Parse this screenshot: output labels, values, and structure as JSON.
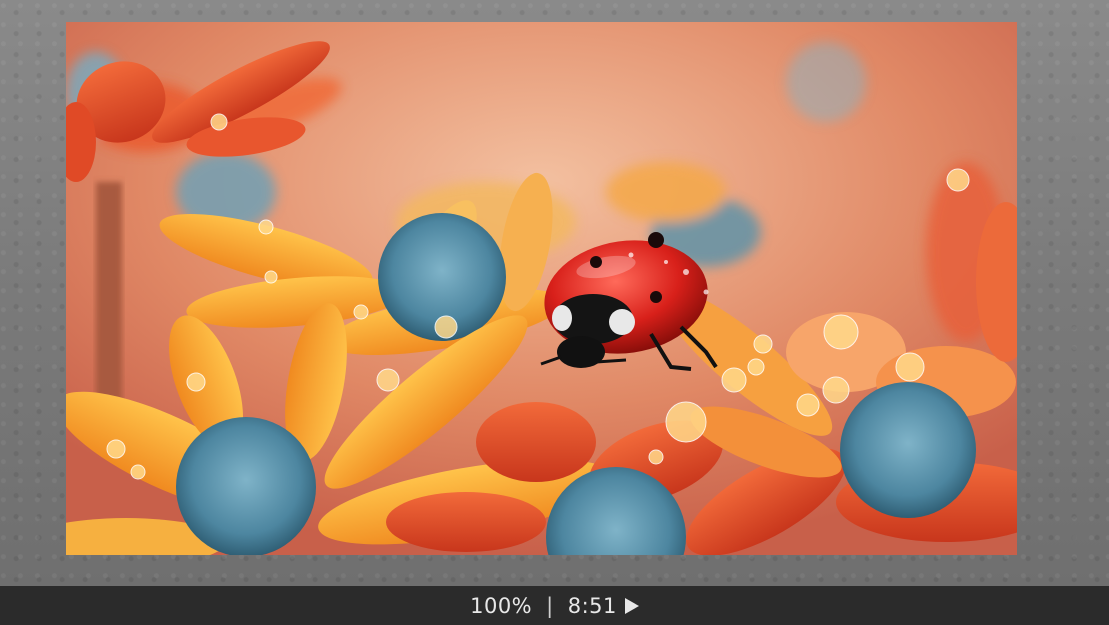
{
  "statusbar": {
    "zoom": "100%",
    "separator": "|",
    "time": "8:51"
  },
  "icons": {
    "play": "play-icon"
  },
  "colors": {
    "statusbar_bg": "#2b2b2b",
    "viewer_bg": "#7a7a7a"
  }
}
